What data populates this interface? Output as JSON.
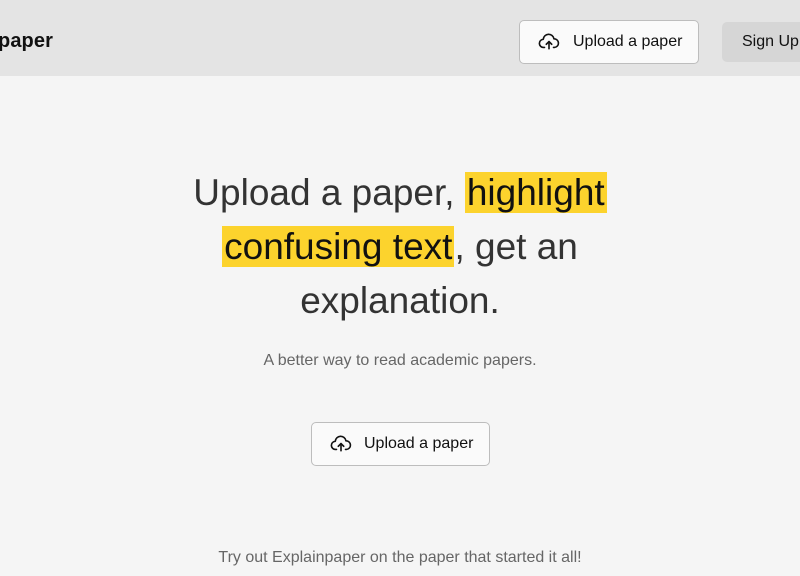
{
  "header": {
    "brand": "paper",
    "upload_label": "Upload a paper",
    "signup_label": "Sign Up"
  },
  "hero": {
    "part1": "Upload a paper,",
    "highlight1": "highlight",
    "highlight2": "confusing text",
    "part2": ", get an explanation."
  },
  "subtitle": "A better way to read academic papers.",
  "main_upload_label": "Upload a paper",
  "footer_text": "Try out Explainpaper on the paper that started it all!",
  "colors": {
    "highlight": "#fcd32d",
    "header_bg": "#e4e4e4",
    "page_bg": "#f5f5f5"
  },
  "icons": {
    "upload": "cloud-upload-icon"
  }
}
